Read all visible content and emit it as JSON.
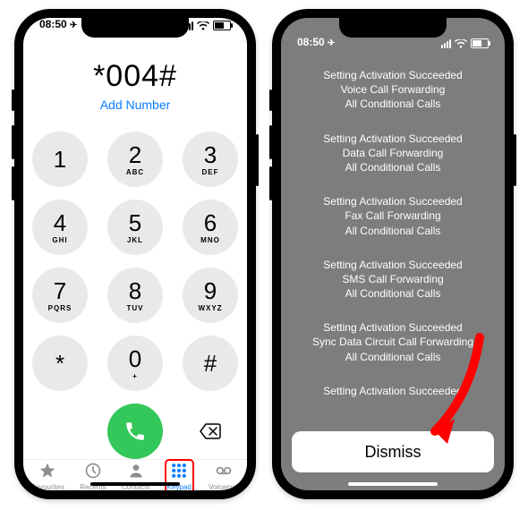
{
  "status": {
    "time": "08:50"
  },
  "dialer": {
    "entered": "*004#",
    "add_number": "Add Number",
    "keys": [
      {
        "d": "1",
        "l": ""
      },
      {
        "d": "2",
        "l": "ABC"
      },
      {
        "d": "3",
        "l": "DEF"
      },
      {
        "d": "4",
        "l": "GHI"
      },
      {
        "d": "5",
        "l": "JKL"
      },
      {
        "d": "6",
        "l": "MNO"
      },
      {
        "d": "7",
        "l": "PQRS"
      },
      {
        "d": "8",
        "l": "TUV"
      },
      {
        "d": "9",
        "l": "WXYZ"
      },
      {
        "d": "*",
        "l": ""
      },
      {
        "d": "0",
        "l": "+"
      },
      {
        "d": "#",
        "l": ""
      }
    ],
    "tabs": [
      {
        "id": "favourites",
        "label": "Favourites"
      },
      {
        "id": "recents",
        "label": "Recents"
      },
      {
        "id": "contacts",
        "label": "Contacts"
      },
      {
        "id": "keypad",
        "label": "Keypad"
      },
      {
        "id": "voicemail",
        "label": "Voicemail"
      }
    ]
  },
  "result": {
    "messages": [
      [
        "Setting Activation Succeeded",
        "Voice Call Forwarding",
        "All Conditional Calls"
      ],
      [
        "Setting Activation Succeeded",
        "Data Call Forwarding",
        "All Conditional Calls"
      ],
      [
        "Setting Activation Succeeded",
        "Fax Call Forwarding",
        "All Conditional Calls"
      ],
      [
        "Setting Activation Succeeded",
        "SMS Call Forwarding",
        "All Conditional Calls"
      ],
      [
        "Setting Activation Succeeded",
        "Sync Data Circuit Call Forwarding",
        "All Conditional Calls"
      ],
      [
        "Setting Activation Succeeded"
      ]
    ],
    "dismiss": "Dismiss"
  }
}
